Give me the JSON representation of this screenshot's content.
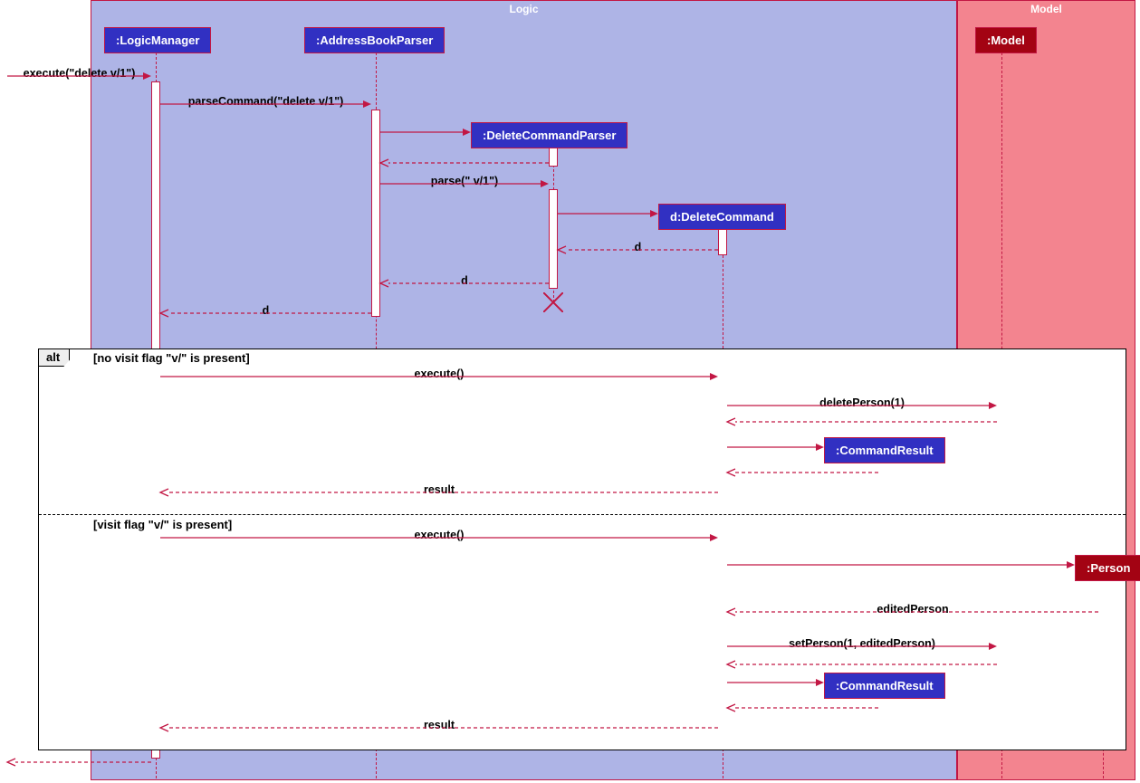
{
  "regions": {
    "logic": "Logic",
    "model": "Model"
  },
  "participants": {
    "logicManager": ":LogicManager",
    "addressBookParser": ":AddressBookParser",
    "deleteCommandParser": ":DeleteCommandParser",
    "deleteCommand": "d:DeleteCommand",
    "model": ":Model",
    "commandResult1": ":CommandResult",
    "commandResult2": ":CommandResult",
    "person": ":Person"
  },
  "messages": {
    "execute_delete": "execute(\"delete v/1\")",
    "parseCommand": "parseCommand(\"delete v/1\")",
    "parse": "parse(\" v/1\")",
    "d": "d",
    "execute1": "execute()",
    "deletePerson": "deletePerson(1)",
    "result1": "result",
    "execute2": "execute()",
    "editedPerson": "editedPerson",
    "setPerson": "setPerson(1, editedPerson)",
    "result2": "result"
  },
  "alt": {
    "label": "alt",
    "cond1": "[no visit flag \"v/\" is present]",
    "cond2": "[visit flag \"v/\" is present]"
  },
  "columns": {
    "external": 8,
    "logicManager": 172,
    "addressBookParser": 415,
    "deleteCommandParser": 611,
    "deleteCommand": 798,
    "commandResult": 975,
    "model": 1106,
    "person": 1218
  }
}
